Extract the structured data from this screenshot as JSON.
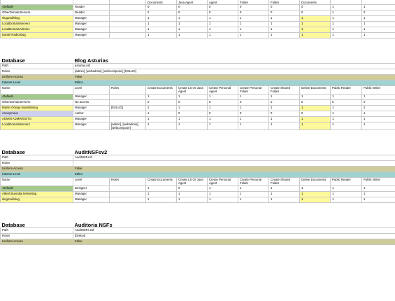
{
  "acl_headers": {
    "name": "Name",
    "level": "Level",
    "roles": "Roles",
    "create_documents": "Create Documents",
    "create_ls": "Create LS Or Java Agent",
    "create_personal_agent": "Create Personal Agent",
    "create_personal_folder": "Create Personal Folder",
    "create_shared_folder": "Create Shared Folder",
    "delete_documents": "Delete Documents",
    "public_reader": "Public Reader",
    "public_writer": "Public Writer"
  },
  "partial_header": {
    "create_documents": "Documents",
    "create_ls": "Java Agent",
    "create_personal_agent": "Agent",
    "create_personal_folder": "Folder",
    "create_shared_folder": "Folder",
    "delete_documents": "Documents"
  },
  "labels": {
    "database": "Database",
    "path": "Path",
    "roles": "Roles",
    "uniform_access": "Uniform Access",
    "internet_level": "Internet Level"
  },
  "top_partial": {
    "entries": [
      {
        "name": "-Default-",
        "level": "Reader",
        "roles": "",
        "cd": "0",
        "cls": "0",
        "cpa": "0",
        "cpf": "0",
        "csf": "0",
        "dd": "0",
        "pr": "1",
        "pw": "1",
        "hl": "green"
      },
      {
        "name": "OtherDomainServers",
        "level": "Reader",
        "roles": "",
        "cd": "0",
        "cls": "0",
        "cpa": "0",
        "cpf": "0",
        "csf": "0",
        "dd": "0",
        "pr": "1",
        "pw": "0",
        "hl": ""
      },
      {
        "name": "slugmail/slug",
        "level": "Manager",
        "roles": "",
        "cd": "1",
        "cls": "1",
        "cpa": "1",
        "cpf": "1",
        "csf": "1",
        "dd": "1",
        "pr": "1",
        "pw": "1",
        "hl": "yellow"
      },
      {
        "name": "LocalDomainServers",
        "level": "Manager",
        "roles": "",
        "cd": "1",
        "cls": "1",
        "cpa": "1",
        "cpf": "1",
        "csf": "1",
        "dd": "1",
        "pr": "1",
        "pw": "1",
        "hl": "yellow"
      },
      {
        "name": "LocalDomainAdmins",
        "level": "Manager",
        "roles": "",
        "cd": "1",
        "cls": "1",
        "cpa": "1",
        "cpf": "1",
        "csf": "1",
        "dd": "1",
        "pr": "1",
        "pw": "1",
        "hl": "yellow"
      },
      {
        "name": "Daniel Radio/slug",
        "level": "Manager",
        "roles": "",
        "cd": "1",
        "cls": "1",
        "cpa": "1",
        "cpf": "1",
        "csf": "1",
        "dd": "1",
        "pr": "1",
        "pw": "1",
        "hl": "yellow"
      }
    ]
  },
  "databases": [
    {
      "title": "Blog Asturias",
      "path": "asturias.nsf",
      "roles": "[admin], [webadmin], [webcompose], [ESLUG]",
      "uniform_access": "False",
      "internet_level": "Editor",
      "entries": [
        {
          "name": "-Default-",
          "level": "Manager",
          "roles": "",
          "cd": "1",
          "cls": "1",
          "cpa": "1",
          "cpf": "1",
          "csf": "1",
          "dd": "1",
          "pr": "1",
          "pw": "1",
          "hl": "green"
        },
        {
          "name": "OtherDomainServers",
          "level": "No access",
          "roles": "",
          "cd": "0",
          "cls": "0",
          "cpa": "0",
          "cpf": "0",
          "csf": "0",
          "dd": "0",
          "pr": "0",
          "pw": "0",
          "hl": ""
        },
        {
          "name": "Martin Ortega Novella/slug",
          "level": "Manager",
          "roles": "[ESLUG]",
          "cd": "1",
          "cls": "1",
          "cpa": "1",
          "cpf": "1",
          "csf": "1",
          "dd": "1",
          "pr": "1",
          "pw": "1",
          "hl": "yellow"
        },
        {
          "name": "Anonymous",
          "level": "Author",
          "roles": "",
          "cd": "1",
          "cls": "0",
          "cpa": "0",
          "cpf": "0",
          "csf": "0",
          "dd": "0",
          "pr": "1",
          "pw": "1",
          "hl": "blue"
        },
        {
          "name": "ADMIN ADMIN/SOTO",
          "level": "Manager",
          "roles": "",
          "cd": "1",
          "cls": "1",
          "cpa": "1",
          "cpf": "1",
          "csf": "1",
          "dd": "1",
          "pr": "1",
          "pw": "1",
          "hl": "yellow"
        },
        {
          "name": "LocalDomainServers",
          "level": "Manager",
          "roles": "[admin], [webadmin], [webcompose]",
          "cd": "1",
          "cls": "1",
          "cpa": "1",
          "cpf": "1",
          "csf": "1",
          "dd": "1",
          "pr": "1",
          "pw": "1",
          "hl": "yellow"
        }
      ]
    },
    {
      "title": "AuditNSFsv2",
      "path": "AuditNSF.nsf",
      "roles": "",
      "uniform_access": "False",
      "internet_level": "Editor",
      "entries": [
        {
          "name": "-Default-",
          "level": "Designer",
          "roles": "",
          "cd": "1",
          "cls": "0",
          "cpa": "1",
          "cpf": "1",
          "csf": "1",
          "dd": "1",
          "pr": "1",
          "pw": "1",
          "hl": "green"
        },
        {
          "name": "Albert Buendia Seles/slug",
          "level": "Manager",
          "roles": "",
          "cd": "1",
          "cls": "1",
          "cpa": "1",
          "cpf": "1",
          "csf": "1",
          "dd": "1",
          "pr": "1",
          "pw": "1",
          "hl": "yellow"
        },
        {
          "name": "slugmail/slug",
          "level": "Manager",
          "roles": "",
          "cd": "1",
          "cls": "1",
          "cpa": "1",
          "cpf": "1",
          "csf": "1",
          "dd": "1",
          "pr": "1",
          "pw": "1",
          "hl": "yellow"
        }
      ]
    },
    {
      "title": "Auditoria NSFs",
      "path": "AuditNSFs.nsf",
      "roles": "[Diskus]",
      "uniform_access": "False",
      "internet_level": "",
      "entries": []
    }
  ]
}
